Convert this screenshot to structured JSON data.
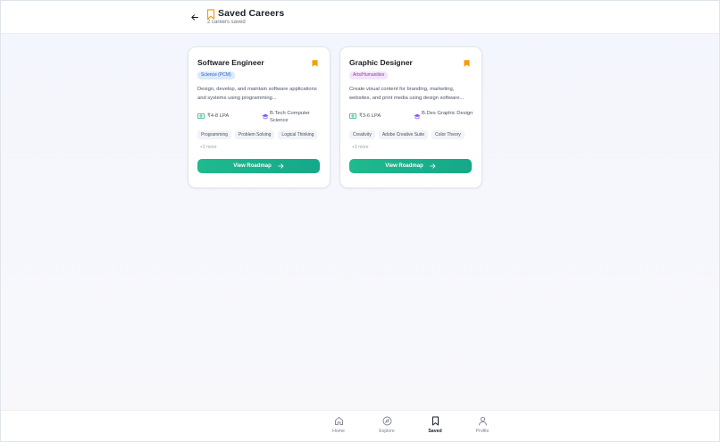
{
  "header": {
    "title": "Saved Careers",
    "subtitle": "2 careers saved",
    "back_icon": "arrow-left-icon",
    "title_icon": "bookmark-outline-icon"
  },
  "colors": {
    "accent_green": "#1fba8d",
    "bookmark_orange": "#f59e0b",
    "science_badge_bg": "#dbe9fd",
    "arts_badge_bg": "#f3e4fb"
  },
  "cards": [
    {
      "title": "Software Engineer",
      "stream": "Science (PCM)",
      "description": "Design, develop, and maintain software applications and systems using programming...",
      "salary": "₹4-8 LPA",
      "degree": "B.Tech Computer Science",
      "skills": [
        "Programming",
        "Problem Solving",
        "Logical Thinking"
      ],
      "more_skills": "+3 more",
      "button_label": "View Roadmap"
    },
    {
      "title": "Graphic Designer",
      "stream": "Arts/Humanities",
      "description": "Create visual content for branding, marketing, websites, and print media using design software...",
      "salary": "₹3-6 LPA",
      "degree": "B.Des Graphic Design",
      "skills": [
        "Creativity",
        "Adobe Creative Suite",
        "Color Theory"
      ],
      "more_skills": "+3 more",
      "button_label": "View Roadmap"
    }
  ],
  "bottom_nav": {
    "items": [
      {
        "label": "Home",
        "icon": "home-icon"
      },
      {
        "label": "Explore",
        "icon": "compass-icon"
      },
      {
        "label": "Saved",
        "icon": "bookmark-icon",
        "active": true
      },
      {
        "label": "Profile",
        "icon": "user-icon"
      }
    ]
  }
}
